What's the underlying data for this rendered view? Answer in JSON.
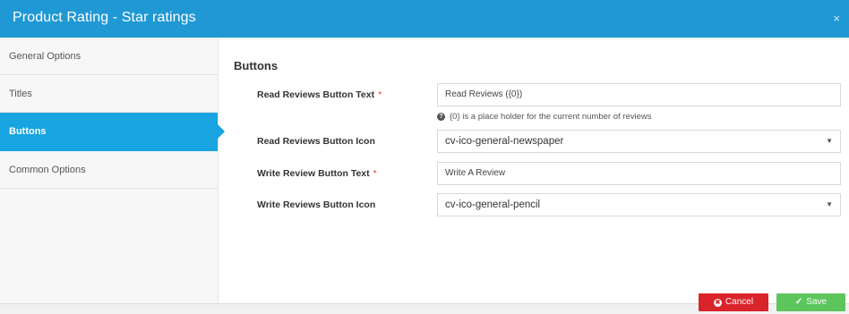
{
  "dialog": {
    "title": "Product Rating - Star ratings",
    "close_glyph": "×"
  },
  "sidebar": {
    "items": [
      {
        "label": "General Options",
        "active": false
      },
      {
        "label": "Titles",
        "active": false
      },
      {
        "label": "Buttons",
        "active": true
      },
      {
        "label": "Common Options",
        "active": false
      }
    ]
  },
  "main": {
    "section_title": "Buttons",
    "fields": {
      "read_text": {
        "label": "Read Reviews Button Text",
        "required_mark": "*",
        "value": "Read Reviews ({0})"
      },
      "hint": {
        "icon": "question-icon",
        "icon_glyph": "?",
        "text": "{0} is a place holder for the current number of reviews"
      },
      "read_icon": {
        "label": "Read Reviews Button Icon",
        "value": "cv-ico-general-newspaper",
        "caret": "▼"
      },
      "write_text": {
        "label": "Write Review Button Text",
        "required_mark": "*",
        "value": "Write A Review"
      },
      "write_icon": {
        "label": "Write Reviews Button Icon",
        "value": "cv-ico-general-pencil",
        "caret": "▼"
      }
    }
  },
  "footer": {
    "cancel_label": "Cancel",
    "cancel_icon": "x-circle-icon",
    "cancel_glyph": "✖",
    "save_label": "Save",
    "save_icon": "check-icon",
    "save_glyph": "✓"
  },
  "colors": {
    "header": "#1f98d4",
    "active_nav": "#17a4e0",
    "cancel": "#d9242b",
    "save": "#5cc65c",
    "required": "#e0433b"
  }
}
